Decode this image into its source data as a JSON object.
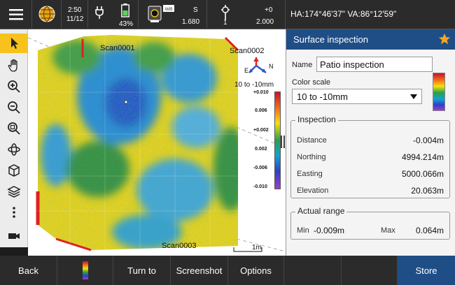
{
  "status_bar": {
    "time": "2:50",
    "date": "11/12",
    "battery_percent": "43%",
    "instrument_label": "S",
    "instrument_value": "1.680",
    "target_label": "1",
    "target_offset": "+0",
    "target_value": "2.000",
    "angles": "HA:174°46'37\"  VA:86°12'59\""
  },
  "map": {
    "scan_labels": [
      "Scan0001",
      "Scan0002",
      "Scan0003"
    ],
    "compass": {
      "north": "N",
      "east": "E"
    },
    "scale_title": "10 to -10mm",
    "scale_ticks": [
      "+0.010",
      "0.006",
      "+0.002",
      "0.002",
      "-0.006",
      "-0.010"
    ],
    "scale_bar_label": "1m"
  },
  "panel": {
    "title": "Surface inspection",
    "name_label": "Name",
    "name_value": "Patio inspection",
    "color_scale_label": "Color scale",
    "color_scale_value": "10 to -10mm",
    "inspection": {
      "title": "Inspection",
      "rows": [
        {
          "label": "Distance",
          "value": "-0.004m"
        },
        {
          "label": "Northing",
          "value": "4994.214m"
        },
        {
          "label": "Easting",
          "value": "5000.066m"
        },
        {
          "label": "Elevation",
          "value": "20.063m"
        }
      ]
    },
    "actual_range": {
      "title": "Actual range",
      "min_label": "Min",
      "min_value": "-0.009m",
      "max_label": "Max",
      "max_value": "0.064m"
    }
  },
  "bottom_bar": {
    "back": "Back",
    "turn_to": "Turn to",
    "screenshot": "Screenshot",
    "options": "Options",
    "store": "Store"
  },
  "colors": {
    "header_blue": "#1f4e86",
    "tool_active": "#f7c21b",
    "star": "#f5a623"
  }
}
